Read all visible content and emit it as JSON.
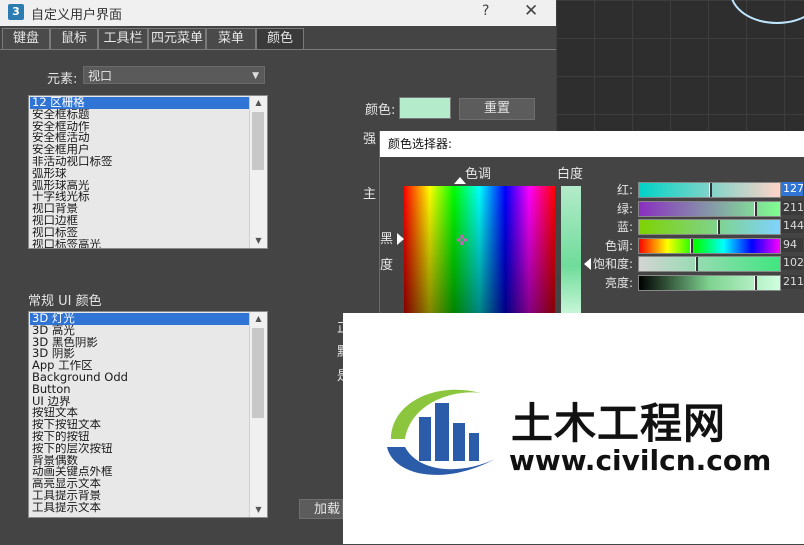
{
  "window": {
    "title": "自定义用户界面",
    "icon_text": "3",
    "help": "?",
    "close": "✕"
  },
  "tabs": [
    {
      "label": "键盘"
    },
    {
      "label": "鼠标"
    },
    {
      "label": "工具栏"
    },
    {
      "label": "四元菜单"
    },
    {
      "label": "菜单"
    },
    {
      "label": "颜色",
      "active": true
    }
  ],
  "element": {
    "label": "元素:",
    "value": "视口"
  },
  "element_list": {
    "items": [
      "12 区栅格",
      "安全框标题",
      "安全框动作",
      "安全框活动",
      "安全框用户",
      "非活动视口标签",
      "弧形球",
      "弧形球高光",
      "十字线光标",
      "视口背景",
      "视口边框",
      "视口标签",
      "视口标签高光"
    ],
    "selected_index": 0
  },
  "general": {
    "label": "常规 UI 颜色",
    "items": [
      "3D 灯光",
      "3D 高光",
      "3D 黑色阴影",
      "3D 阴影",
      "App 工作区",
      "Background Odd",
      "Button",
      "UI 边界",
      "按钮文本",
      "按下按钮文本",
      "按下的按钮",
      "按下的层次按钮",
      "背景偶数",
      "动画关键点外框",
      "高亮显示文本",
      "工具提示背景",
      "工具提示文本"
    ],
    "selected_index": 0
  },
  "color": {
    "label": "颜色:",
    "swatch": "#b4ebcb",
    "reset_label": "重置"
  },
  "partial_labels": {
    "strong": "强",
    "main": "主",
    "load": "加载",
    "bg1": "正",
    "bg2": "默",
    "bg3": "是"
  },
  "picker": {
    "title": "颜色选择器:",
    "hue_label": "色调",
    "whiteness_label": "白度",
    "blackness_label_1": "黑",
    "blackness_label_2": "度",
    "sliders": [
      {
        "label": "红:",
        "value": "127",
        "fraction": 0.5,
        "selected": true
      },
      {
        "label": "绿:",
        "value": "211",
        "fraction": 0.83,
        "selected": false
      },
      {
        "label": "蓝:",
        "value": "144",
        "fraction": 0.56,
        "selected": false
      },
      {
        "label": "色调:",
        "value": "94",
        "fraction": 0.37,
        "selected": false
      },
      {
        "label": "饱和度:",
        "value": "102",
        "fraction": 0.4,
        "selected": false
      },
      {
        "label": "亮度:",
        "value": "211",
        "fraction": 0.83,
        "selected": false
      }
    ]
  },
  "watermark": {
    "cn": "土木工程网",
    "url": "www.civilcn.com"
  }
}
